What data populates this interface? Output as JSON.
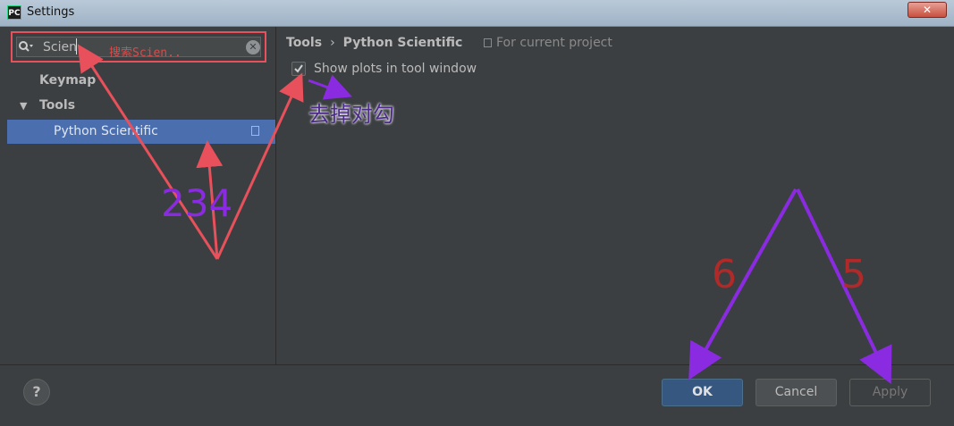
{
  "window": {
    "app_icon": "PC",
    "title": "Settings",
    "close_label": "✕"
  },
  "search": {
    "value": "Scien",
    "annotation": "搜索Scien.."
  },
  "tree": {
    "items": [
      {
        "label": "Keymap"
      },
      {
        "label": "Tools",
        "expanded": true
      },
      {
        "label": "Python Scientific",
        "selected": true
      }
    ]
  },
  "breadcrumb": {
    "parent": "Tools",
    "separator": "›",
    "current": "Python Scientific"
  },
  "scope_note": "For current project",
  "option": {
    "label": "Show plots in tool window",
    "checked": true
  },
  "annotations": {
    "uncheck": "去掉对勾",
    "step_numbers": "234",
    "step6": "6",
    "step5": "5"
  },
  "footer": {
    "help": "?",
    "ok": "OK",
    "cancel": "Cancel",
    "apply": "Apply"
  },
  "colors": {
    "accent_selected": "#4b6eaf",
    "ok_button": "#365880",
    "annotation_red": "#e8505b",
    "annotation_purple": "#8a2be2"
  }
}
